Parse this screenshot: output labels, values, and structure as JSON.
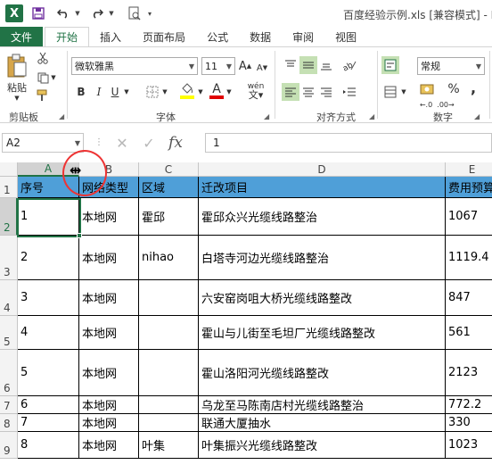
{
  "titlebar": {
    "title": "百度经验示例.xls  [兼容模式] - Ex",
    "excel_logo": "X",
    "save_icon": "save-icon",
    "undo_icon": "undo-icon",
    "redo_icon": "redo-icon",
    "preview_icon": "print-preview-icon"
  },
  "tabs": [
    "文件",
    "开始",
    "插入",
    "页面布局",
    "公式",
    "数据",
    "审阅",
    "视图"
  ],
  "ribbon": {
    "clipboard": {
      "paste_label": "粘贴",
      "group_label": "剪贴板"
    },
    "font": {
      "font_name": "微软雅黑",
      "font_size": "11",
      "bold": "B",
      "italic": "I",
      "underline": "U",
      "font_color_letter": "A",
      "size_up": "A",
      "size_down": "A",
      "phonetic": "wén",
      "group_label": "字体"
    },
    "alignment": {
      "group_label": "对齐方式"
    },
    "number": {
      "format": "常规",
      "percent": "%",
      "comma": ",",
      "group_label": "数字"
    }
  },
  "formula_bar": {
    "name_box": "A2",
    "fx_label": "fx",
    "cancel_symbol": "✕",
    "enter_symbol": "✓",
    "value": "1"
  },
  "grid": {
    "columns": [
      "A",
      "B",
      "C",
      "D",
      "E"
    ],
    "selected_column": "A",
    "selected_row": "2",
    "rows": [
      {
        "num": "1",
        "cells": [
          "序号",
          "网络类型",
          "区域",
          "迁改项目",
          "费用预算"
        ]
      },
      {
        "num": "2",
        "cells": [
          "1",
          "本地网",
          "霍邱",
          "霍邱众兴光缆线路整治",
          "1067"
        ]
      },
      {
        "num": "3",
        "cells": [
          "2",
          "本地网",
          "nihao",
          "白塔寺河边光缆线路整治",
          "1119.4"
        ]
      },
      {
        "num": "4",
        "cells": [
          "3",
          "本地网",
          "",
          "六安窑岗咀大桥光缆线路整改",
          "847"
        ]
      },
      {
        "num": "5",
        "cells": [
          "4",
          "本地网",
          "",
          "霍山与儿街至毛坦厂光缆线路整改",
          "561"
        ]
      },
      {
        "num": "6",
        "cells": [
          "5",
          "本地网",
          "",
          "霍山洛阳河光缆线路整改",
          "2123"
        ]
      },
      {
        "num": "7",
        "cells": [
          "6",
          "本地网",
          "",
          "乌龙至马陈南店村光缆线路整治",
          "772.2"
        ]
      },
      {
        "num": "8",
        "cells": [
          "7",
          "本地网",
          "",
          "联通大厦抽水",
          "330"
        ]
      },
      {
        "num": "9",
        "cells": [
          "8",
          "本地网",
          "叶集",
          "叶集振兴光缆线路整改",
          "1023"
        ]
      }
    ]
  },
  "colors": {
    "excel_green": "#217346",
    "header_fill": "#4f9fd8",
    "highlight_circle": "#e33333"
  }
}
